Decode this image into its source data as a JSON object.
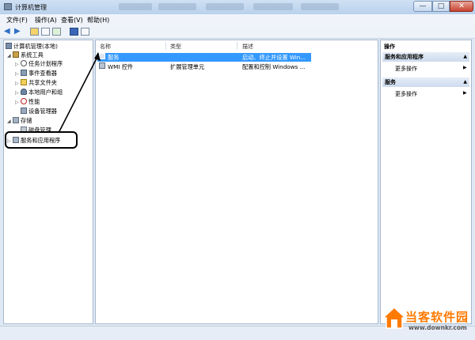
{
  "window": {
    "title": "计算机管理",
    "min_label": "—",
    "max_label": "□",
    "close_label": "✕"
  },
  "menu": [
    "文件(F)",
    "操作(A)",
    "查看(V)",
    "帮助(H)"
  ],
  "tree": {
    "root": "计算机管理(本地)",
    "system_tools": "系统工具",
    "items": [
      "任务计划程序",
      "事件查看器",
      "共享文件夹",
      "本地用户和组",
      "性能",
      "设备管理器"
    ],
    "storage": "存储",
    "disk_mgmt": "磁盘管理",
    "services_apps": "服务和应用程序"
  },
  "list": {
    "headers": {
      "name": "名称",
      "type": "类型",
      "desc": "描述"
    },
    "rows": [
      {
        "name": "服务",
        "type": "",
        "desc": "启动、终止并设置 Win..."
      },
      {
        "name": "WMI 控件",
        "type": "扩展管理单元",
        "desc": "配置和控制 Windows ..."
      }
    ]
  },
  "actions": {
    "title": "操作",
    "section1": "服务和应用程序",
    "section1_more": "更多操作",
    "section2": "服务",
    "section2_more": "更多操作"
  },
  "watermark": {
    "brand": "当客软件园",
    "url": "www.downkr.com"
  },
  "colors": {
    "selection": "#3399ff",
    "accent": "#ff7a00"
  }
}
